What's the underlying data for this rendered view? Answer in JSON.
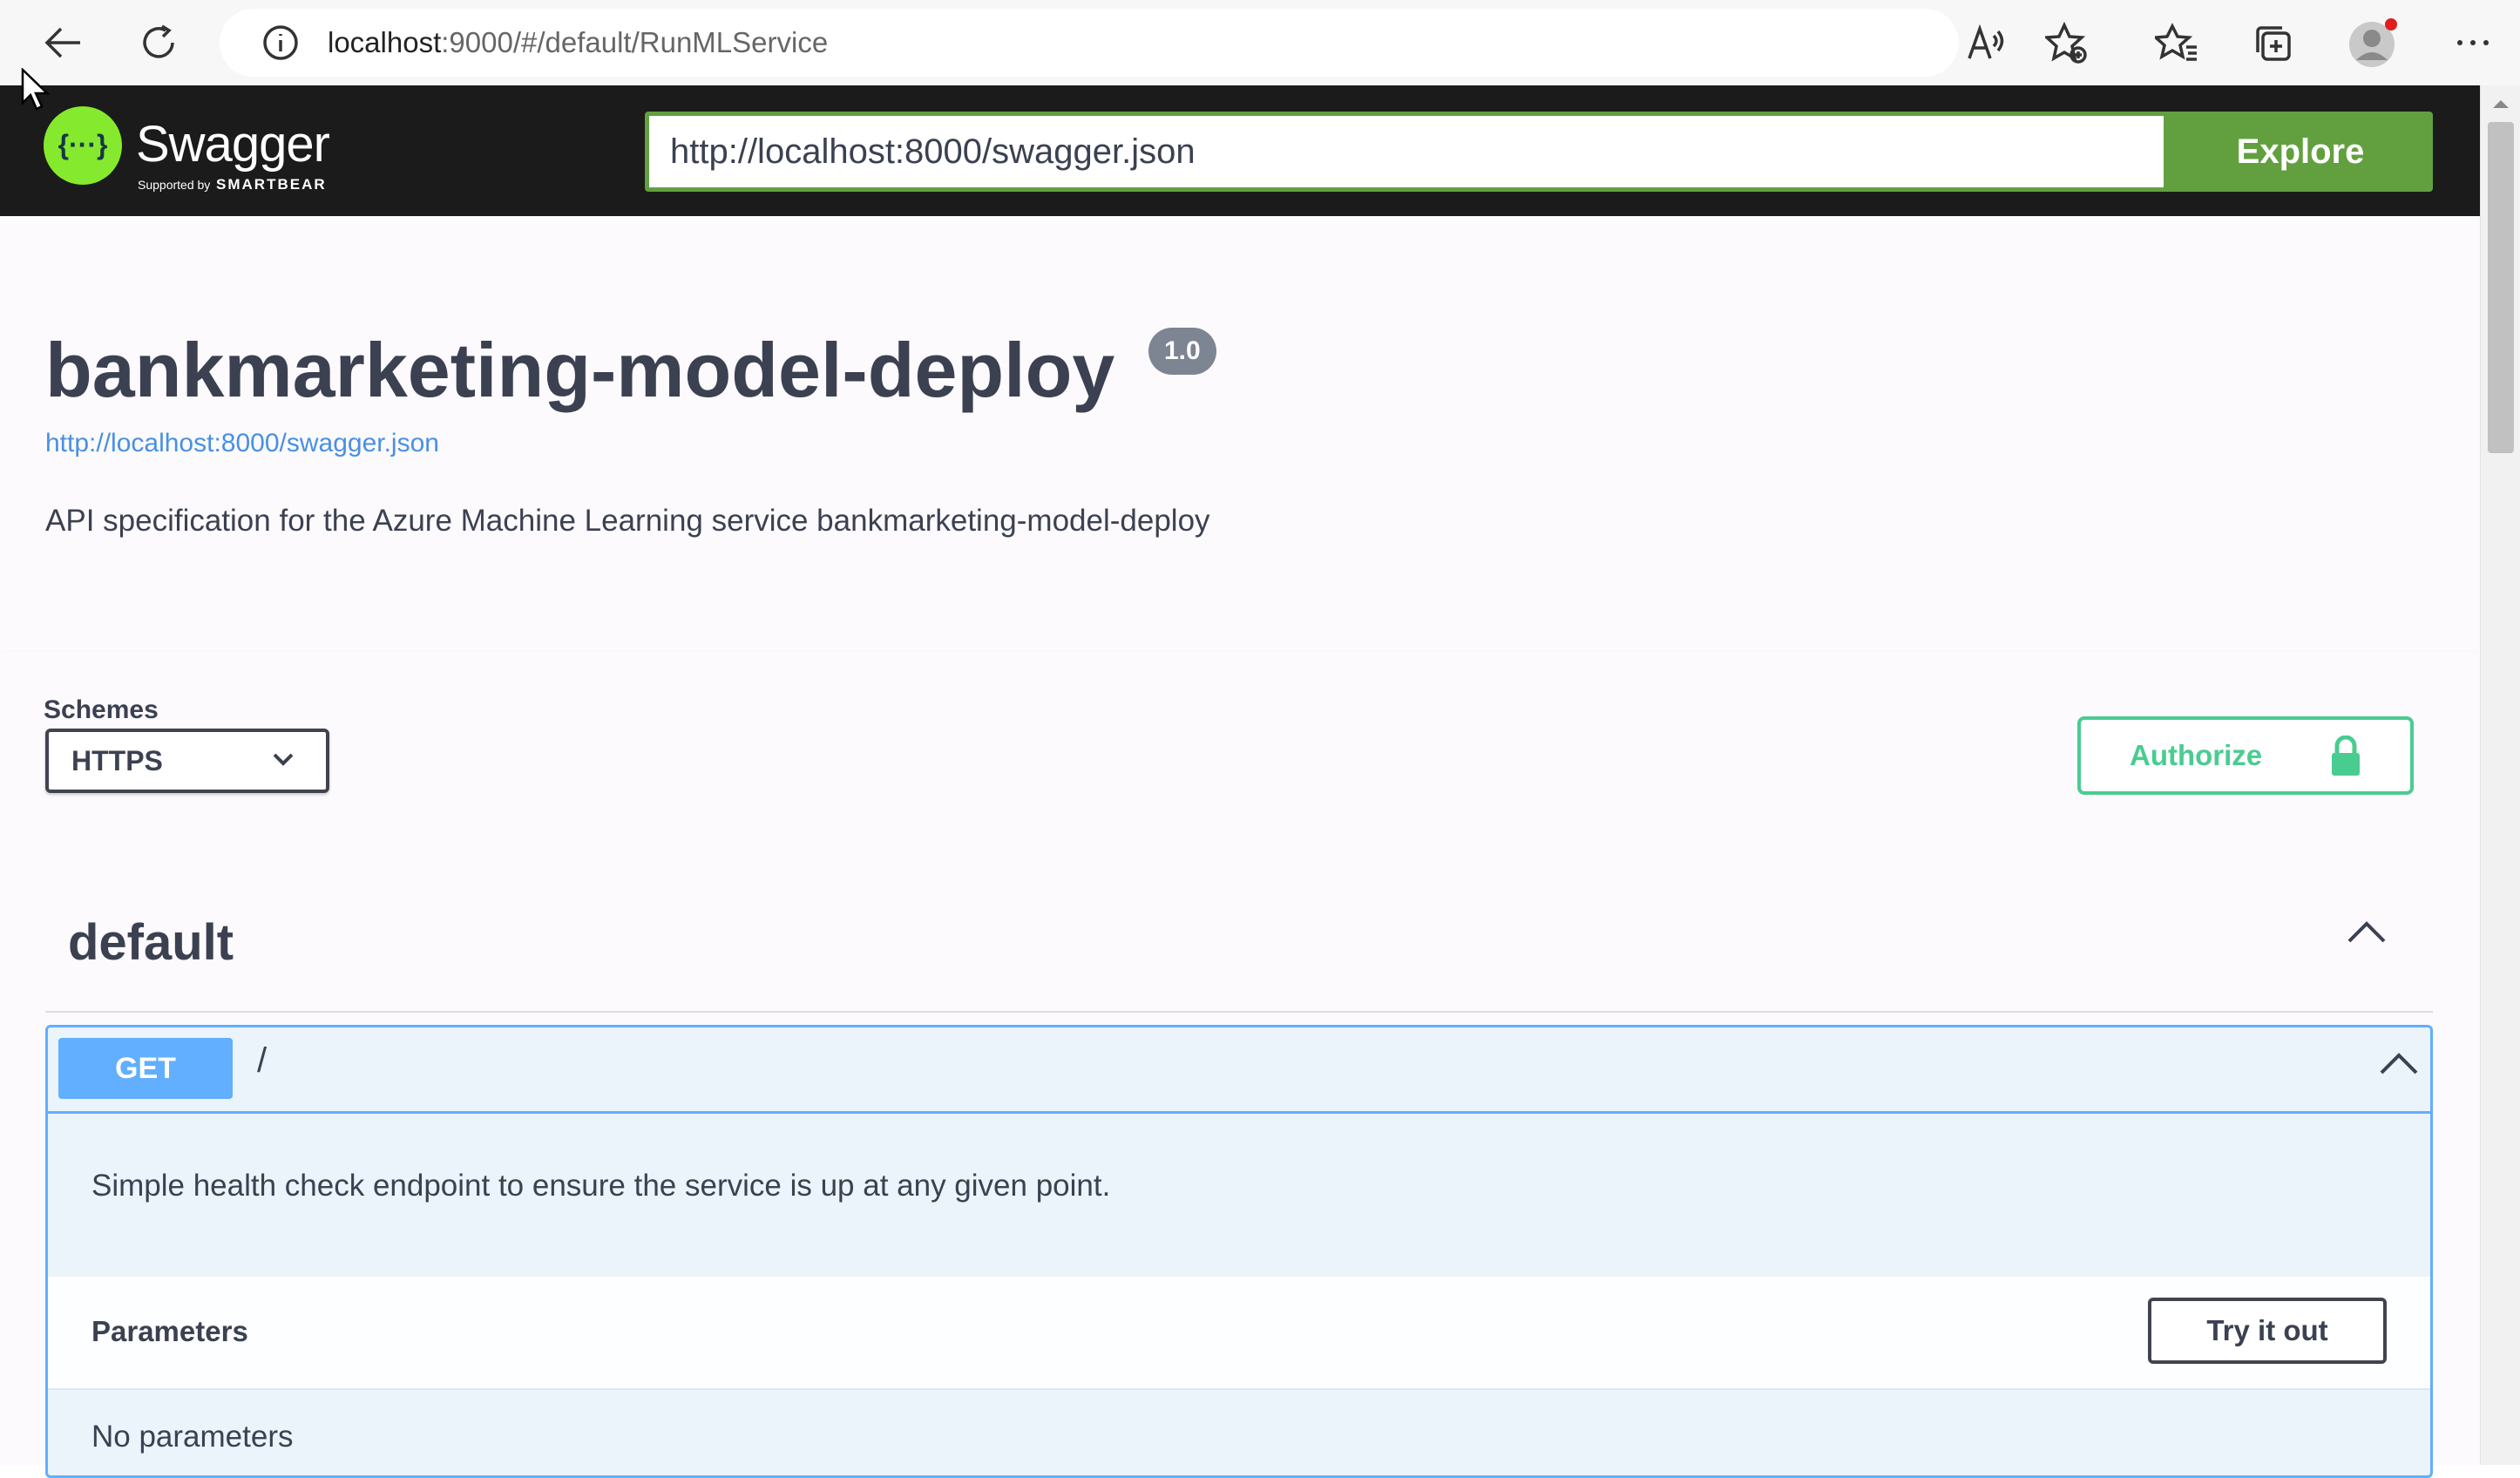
{
  "browser": {
    "url_host": "localhost",
    "url_rest": ":9000/#/default/RunMLService",
    "icons": [
      "back-arrow-icon",
      "reload-icon",
      "info-icon",
      "read-aloud-icon",
      "add-favorite-icon",
      "favorites-icon",
      "collections-icon",
      "profile-icon",
      "more-icon"
    ]
  },
  "topbar": {
    "logo_name": "Swagger",
    "logo_supported": "Supported by",
    "logo_company": "SMARTBEAR",
    "spec_url": "http://localhost:8000/swagger.json",
    "explore_label": "Explore",
    "brand_color": "#85ea2d",
    "explore_color": "#62a03f"
  },
  "info": {
    "title": "bankmarketing-model-deploy",
    "version": "1.0",
    "spec_link": "http://localhost:8000/swagger.json",
    "description": "API specification for the Azure Machine Learning service bankmarketing-model-deploy"
  },
  "schemes": {
    "label": "Schemes",
    "selected": "HTTPS",
    "authorize_label": "Authorize",
    "authorize_color": "#49cc90"
  },
  "operations": {
    "tag": "default",
    "items": [
      {
        "method": "GET",
        "path": "/",
        "description": "Simple health check endpoint to ensure the service is up at any given point.",
        "parameters_title": "Parameters",
        "try_label": "Try it out",
        "no_params": "No parameters",
        "method_color": "#61affe"
      }
    ]
  }
}
